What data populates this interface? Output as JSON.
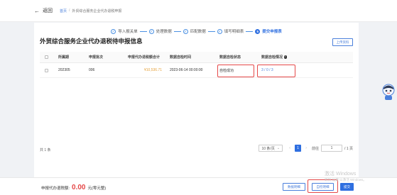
{
  "nav": {
    "back_label": "返回",
    "breadcrumb_home": "首页",
    "breadcrumb_current": "外贸综合服务企业代办退税申报"
  },
  "steps": [
    {
      "label": "导入报关单",
      "state": "done"
    },
    {
      "label": "处理数据",
      "state": "done"
    },
    {
      "label": "匹配数据",
      "state": "done"
    },
    {
      "label": "填写明细表",
      "state": "done"
    },
    {
      "label": "提交申报表",
      "state": "active",
      "number": "5"
    }
  ],
  "page": {
    "title": "外贸综合服务企业代办退税待申报信息",
    "upload_button": "上传资料"
  },
  "table": {
    "headers": [
      "所属期",
      "申报批次",
      "申报代办退税额合计",
      "数据自检时间",
      "数据自检状态",
      "数据自检情况"
    ],
    "rows": [
      {
        "period": "202305",
        "batch": "006",
        "amount": "¥10,536.71",
        "check_time": "2023-06-14 00:00:00",
        "check_status": "自检成功",
        "check_result": "3 / 0 / 3"
      }
    ]
  },
  "pagination": {
    "total": "共 1 条",
    "page_size": "10 条/页",
    "current_page": "1",
    "goto_label": "前往",
    "goto_value": "1",
    "page_count": "/ 1 页"
  },
  "footer": {
    "sum_label": "申报代办退税额:",
    "sum_value": "0.00",
    "sum_unit": "元(零元整)",
    "btn_detail": "数据明细",
    "btn_selfcheck": "自检明细",
    "btn_submit": "提交"
  },
  "watermark": {
    "line1": "激活 Windows",
    "line2": "转到\"设置\"以激活 Windows。"
  },
  "colors": {
    "primary": "#2f6fe0",
    "highlight": "#e54848",
    "amount": "#e5a13b"
  }
}
